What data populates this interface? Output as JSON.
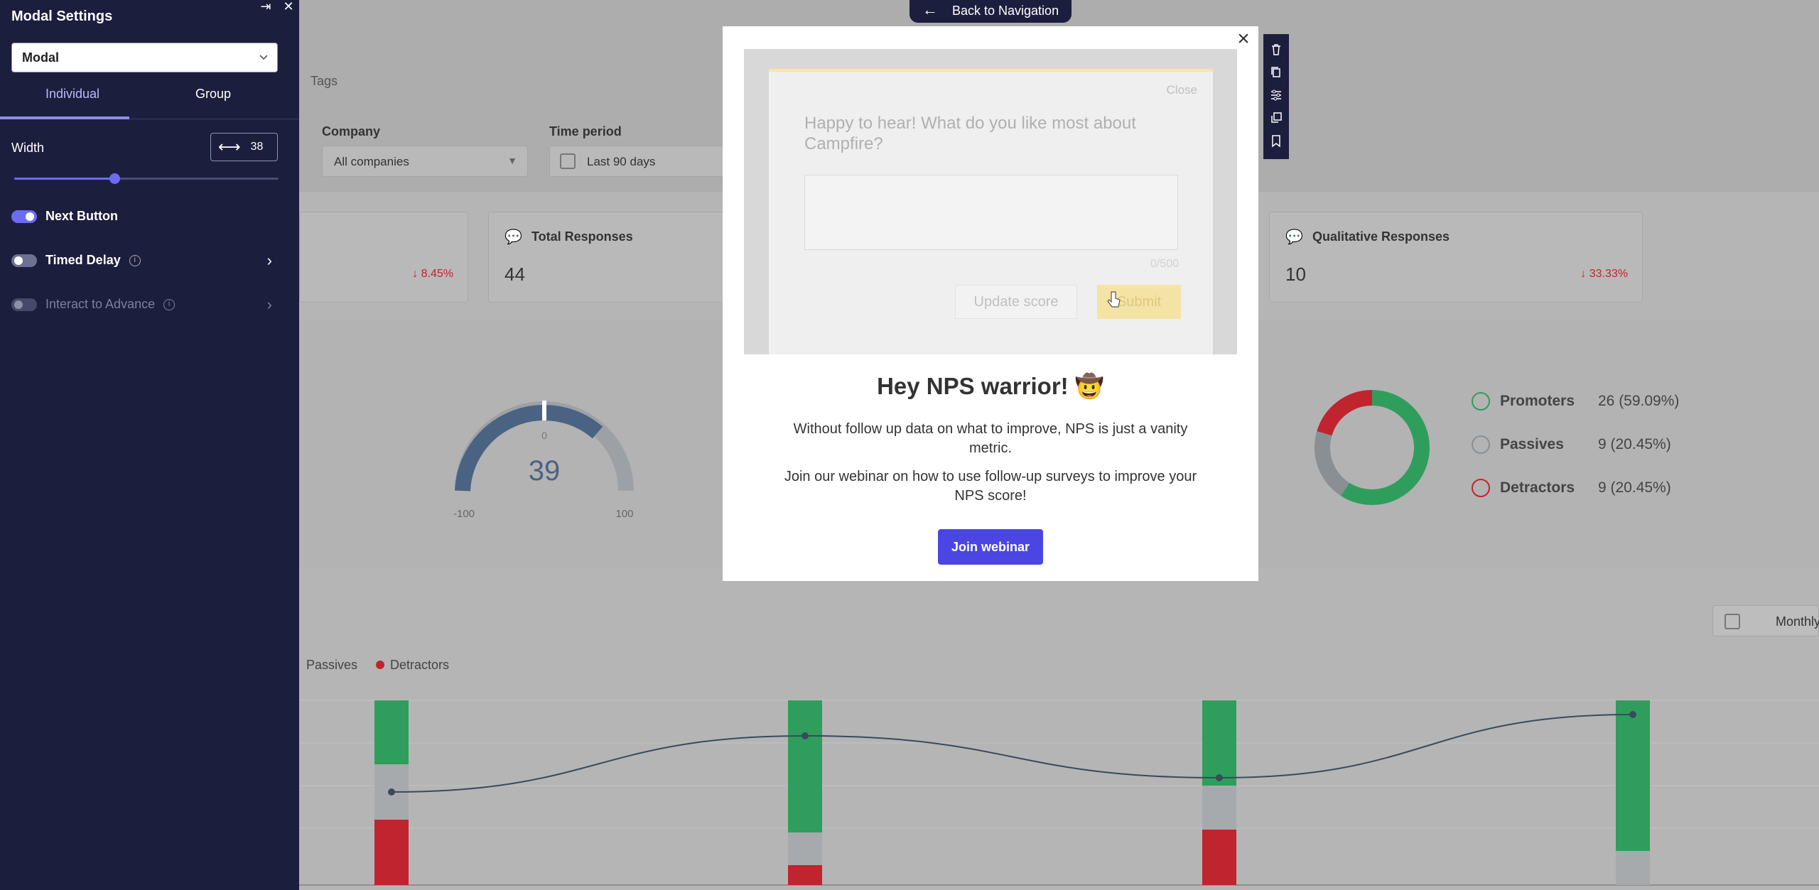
{
  "sidebar": {
    "title": "Modal Settings",
    "type_select": "Modal",
    "tabs": [
      "Individual",
      "Group"
    ],
    "width_label": "Width",
    "width_value": "38",
    "slider_fraction": 0.38,
    "toggles": [
      {
        "label": "Next Button",
        "state": "on"
      },
      {
        "label": "Timed Delay",
        "state": "off"
      },
      {
        "label": "Interact to Advance",
        "state": "disabled"
      }
    ]
  },
  "back_nav": "Back to Navigation",
  "dashboard": {
    "tags": "Tags",
    "filters": [
      {
        "label": "Company",
        "value": "All companies"
      },
      {
        "label": "Time period",
        "value": "Last 90 days"
      }
    ],
    "cards": [
      {
        "title": "",
        "value": "",
        "delta": "8.45%"
      },
      {
        "title": "Total Responses",
        "value": "44",
        "delta": ""
      },
      {
        "title": "Qualitative Responses",
        "value": "10",
        "delta": "33.33%"
      }
    ],
    "gauge": {
      "value": "39",
      "min": "-100",
      "max": "100",
      "zero": "0"
    },
    "breakdown": [
      {
        "label": "Promoters",
        "value": "26",
        "pct": "(59.09%)",
        "color": "#2f9e5c"
      },
      {
        "label": "Passives",
        "value": "9",
        "pct": "(20.45%)",
        "color": "#8a8f94"
      },
      {
        "label": "Detractors",
        "value": "9",
        "pct": "(20.45%)",
        "color": "#c0242f"
      }
    ],
    "legend": [
      {
        "label": "Passives",
        "color": ""
      },
      {
        "label": "Detractors",
        "color": "#c0242f"
      }
    ],
    "monthly": "Monthly"
  },
  "modal": {
    "heading": "Hey NPS warrior! 🤠",
    "p1": "Without follow up data on what to improve, NPS is just a vanity metric.",
    "p2": "Join our webinar on how to use follow-up surveys to improve your NPS score!",
    "cta": "Join webinar",
    "preview": {
      "close": "Close",
      "question": "Happy to hear! What do you like most about Campfire?",
      "counter": "0/500",
      "update": "Update score",
      "submit": "Submit"
    }
  },
  "colors": {
    "accent": "#4b45e4",
    "sidebar_bg": "#1c1e3d",
    "promoter": "#2f9e5c",
    "passive": "#a7aaad",
    "detractor": "#c0242f"
  }
}
